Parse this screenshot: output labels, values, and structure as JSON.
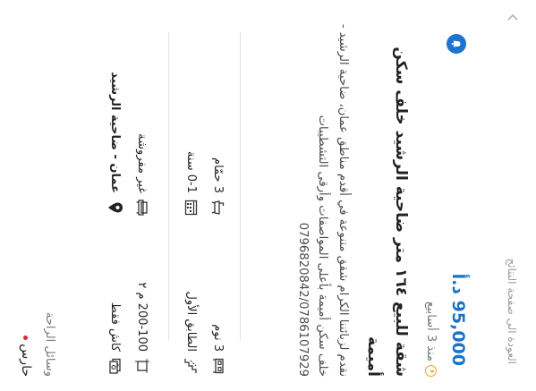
{
  "nav": {
    "back_label": "العودة الى صفحة النتائج"
  },
  "listing": {
    "price": "95,000 د.أ",
    "posted": "منذ 3 أسابيع",
    "title": "شقة للبيع ١٦٤ متر ضاحية الرشيد خلف سكن أميمة",
    "description": "نقدم لزبائننا الكرام شقق متنوعة في أقدم مناطق عمان، ضاحية الرشيد - خلف سكن أميمة بأعلى المواصفات وأرقى التشطيبات 0796820842/0786107929"
  },
  "features": {
    "bedrooms": "3 نوم",
    "bathrooms": "3 حمّام",
    "floor": "الطابق الأول",
    "age": "0-1 سنة",
    "area": "200-100 م ٢",
    "furnishing": "غير مفروشة",
    "payment": "كاش فقط",
    "location": "عمان - ضاحية الرشيد"
  },
  "amenities": {
    "title": "وسائل الراحة",
    "items": [
      "حارس"
    ]
  },
  "colors": {
    "price": "#1c73c4",
    "accent": "#1d74d0",
    "clock": "#f0a020",
    "amenity_dot": "#e0262f"
  }
}
